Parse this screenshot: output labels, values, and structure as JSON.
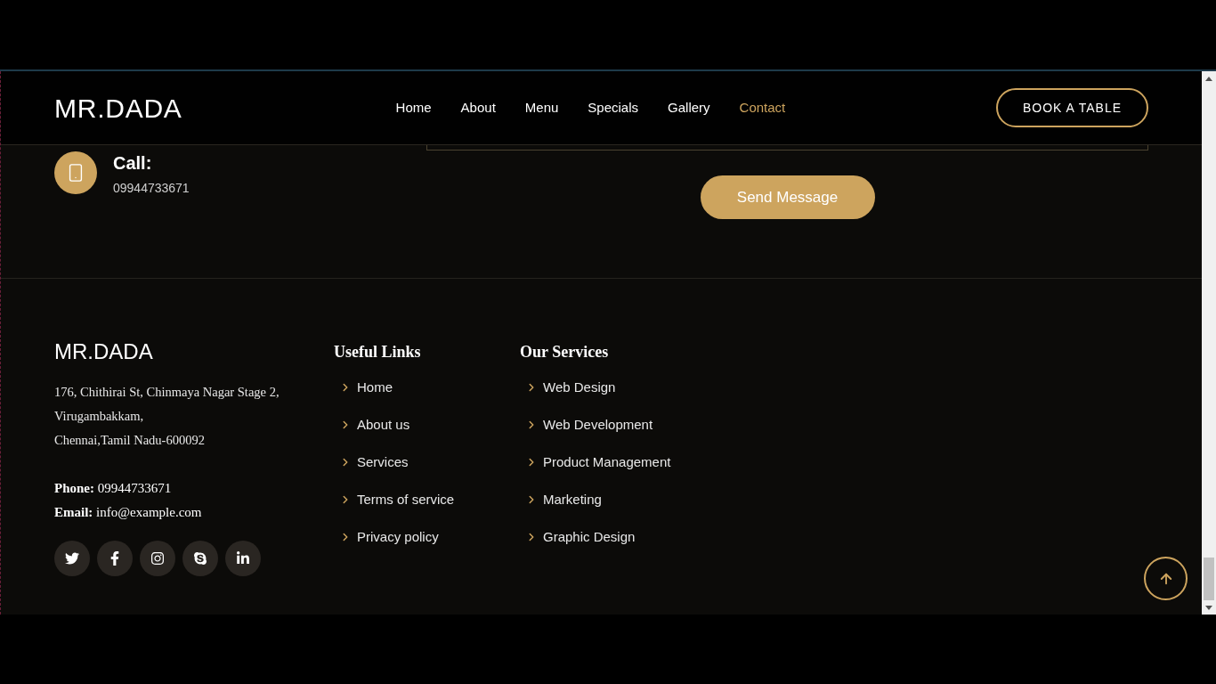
{
  "header": {
    "logo": "MR.DADA",
    "nav": [
      {
        "label": "Home",
        "selected": false
      },
      {
        "label": "About",
        "selected": false
      },
      {
        "label": "Menu",
        "selected": false
      },
      {
        "label": "Specials",
        "selected": false
      },
      {
        "label": "Gallery",
        "selected": false
      },
      {
        "label": "Contact",
        "selected": true
      }
    ],
    "cta": "BOOK A TABLE"
  },
  "contact": {
    "items": [
      {
        "kind": "phone",
        "label": "Call:",
        "value": "09944733671"
      }
    ],
    "send_button": "Send Message"
  },
  "footer": {
    "brand": "MR.DADA",
    "address": [
      "176, Chithirai St, Chinmaya Nagar Stage 2,",
      "Virugambakkam,",
      "Chennai,Tamil Nadu-600092"
    ],
    "phone": "**Phone:** 09944733671",
    "email": "**Email:** info@example.com",
    "socials": [
      {
        "kind": "twitter"
      },
      {
        "kind": "facebook"
      },
      {
        "kind": "instagram"
      },
      {
        "kind": "skype"
      },
      {
        "kind": "linkedin"
      }
    ],
    "columns": [
      {
        "title": "Useful Links",
        "links": [
          "Home",
          "About us",
          "Services",
          "Terms of service",
          "Privacy policy"
        ]
      },
      {
        "title": "Our Services",
        "links": [
          "Web Design",
          "Web Development",
          "Product Management",
          "Marketing",
          "Graphic Design"
        ]
      }
    ]
  }
}
